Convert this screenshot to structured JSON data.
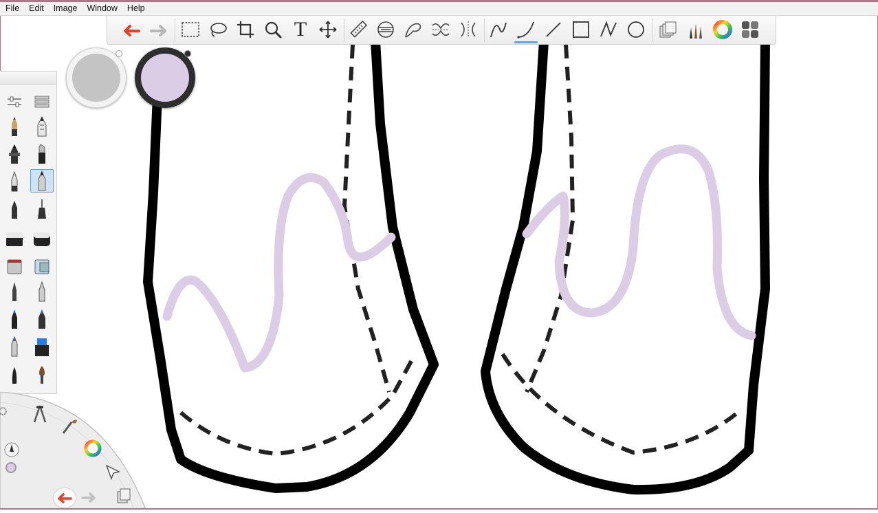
{
  "menu": {
    "items": [
      "File",
      "Edit",
      "Image",
      "Window",
      "Help"
    ]
  },
  "toolbar": {
    "tools": [
      {
        "name": "undo-icon"
      },
      {
        "name": "redo-icon"
      },
      {
        "name": "rect-select-icon"
      },
      {
        "name": "lasso-icon"
      },
      {
        "name": "crop-icon"
      },
      {
        "name": "zoom-icon"
      },
      {
        "name": "text-icon",
        "glyph": "T"
      },
      {
        "name": "transform-icon"
      },
      {
        "name": "ruler-icon"
      },
      {
        "name": "ellipse-guide-icon"
      },
      {
        "name": "french-curve-icon"
      },
      {
        "name": "symmetry-icon"
      },
      {
        "name": "radial-symmetry-icon"
      },
      {
        "name": "curve-icon"
      },
      {
        "name": "curve-active-icon"
      },
      {
        "name": "line-icon"
      },
      {
        "name": "rectangle-icon"
      },
      {
        "name": "polyline-icon"
      },
      {
        "name": "circle-icon"
      },
      {
        "name": "layers-icon"
      },
      {
        "name": "brush-palette-icon"
      },
      {
        "name": "color-wheel-icon"
      },
      {
        "name": "copic-palette-icon"
      }
    ]
  },
  "colors": {
    "current_color": "#dccde6",
    "previous_color": "#c4c4c4",
    "stroke_color": "#ddd0e6",
    "window_border": "#b2768a",
    "active_highlight": "#6aa2d8"
  }
}
